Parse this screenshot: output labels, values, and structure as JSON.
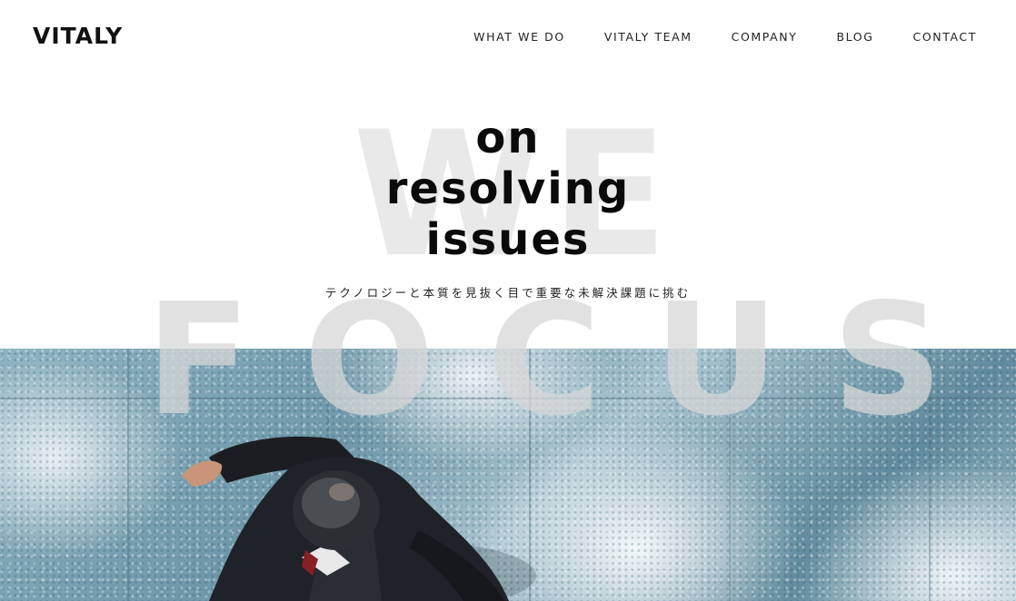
{
  "header": {
    "logo": "VITALY",
    "nav": [
      {
        "label": "WHAT WE DO"
      },
      {
        "label": "VITALY TEAM"
      },
      {
        "label": "COMPANY"
      },
      {
        "label": "BLOG"
      },
      {
        "label": "CONTACT"
      }
    ]
  },
  "hero": {
    "background_words": [
      "WE",
      "FOCUS"
    ],
    "headline": [
      "on",
      "resolving",
      "issues"
    ],
    "subtitle": "テクノロジーと本質を見抜く目で重要な未解決課題に挑む",
    "photo_icon": "businessman-walking-on-tiles-photo"
  },
  "colors": {
    "text": "#111111",
    "watermark": "#e9e9e9",
    "photo_tone": "#6e97a9"
  }
}
